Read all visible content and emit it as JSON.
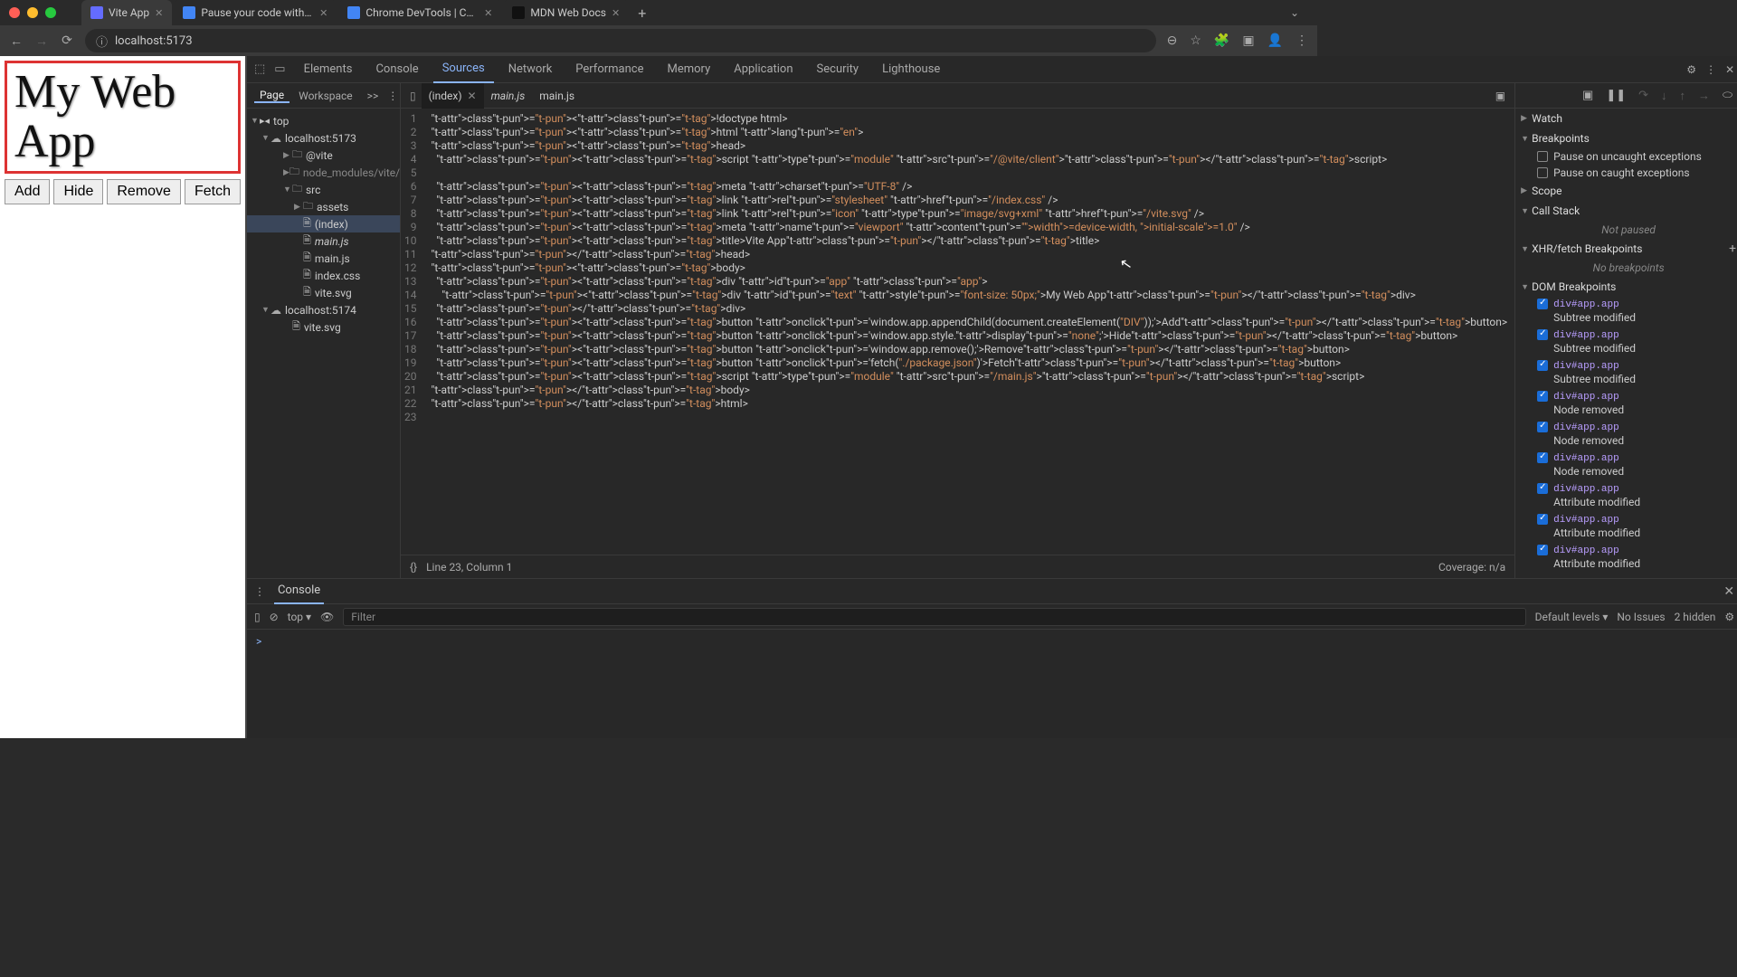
{
  "browser": {
    "tabs": [
      {
        "title": "Vite App",
        "active": true
      },
      {
        "title": "Pause your code with breakp",
        "active": false
      },
      {
        "title": "Chrome DevTools | Chrome",
        "active": false
      },
      {
        "title": "MDN Web Docs",
        "active": false
      }
    ],
    "url": "localhost:5173"
  },
  "page": {
    "heading": "My Web App",
    "buttons": [
      "Add",
      "Hide",
      "Remove",
      "Fetch"
    ]
  },
  "devtools": {
    "tabs": [
      "Elements",
      "Console",
      "Sources",
      "Network",
      "Performance",
      "Memory",
      "Application",
      "Security",
      "Lighthouse"
    ],
    "activeTab": "Sources",
    "leftTabs": {
      "items": [
        "Page",
        "Workspace"
      ],
      "overflow": ">>"
    },
    "filetree": {
      "root": "top",
      "hosts": [
        {
          "name": "localhost:5173",
          "children": [
            {
              "name": "@vite",
              "type": "folder",
              "open": false,
              "depth": 3
            },
            {
              "name": "node_modules/vite/dis",
              "type": "folder",
              "open": false,
              "color": "#888",
              "depth": 3
            },
            {
              "name": "src",
              "type": "folder",
              "open": true,
              "depth": 3
            },
            {
              "name": "assets",
              "type": "folder",
              "open": false,
              "depth": 4
            },
            {
              "name": "(index)",
              "type": "file",
              "selected": true,
              "depth": 4
            },
            {
              "name": "main.js",
              "type": "file",
              "italic": true,
              "depth": 4
            },
            {
              "name": "main.js",
              "type": "file",
              "depth": 4
            },
            {
              "name": "index.css",
              "type": "file",
              "depth": 4
            },
            {
              "name": "vite.svg",
              "type": "file",
              "depth": 4
            }
          ]
        },
        {
          "name": "localhost:5174",
          "children": [
            {
              "name": "vite.svg",
              "type": "file",
              "depth": 3
            }
          ]
        }
      ]
    },
    "editorTabs": [
      {
        "name": "(index)",
        "active": true
      },
      {
        "name": "main.js",
        "italic": true
      },
      {
        "name": "main.js"
      }
    ],
    "code": [
      "<!doctype html>",
      "<html lang=\"en\">",
      "<head>",
      "  <script type=\"module\" src=\"/@vite/client\"></script>",
      "",
      "  <meta charset=\"UTF-8\" />",
      "  <link rel=\"stylesheet\" href=\"/index.css\" />",
      "  <link rel=\"icon\" type=\"image/svg+xml\" href=\"/vite.svg\" />",
      "  <meta name=\"viewport\" content=\"width=device-width, initial-scale=1.0\" />",
      "  <title>Vite App</title>",
      "</head>",
      "<body>",
      "  <div id=\"app\" class=\"app\">",
      "    <div id=\"text\" style=\"font-size: 50px;\">My Web App</div>",
      "  </div>",
      "  <button onclick='window.app.appendChild(document.createElement(\"DIV\"));'>Add</button>",
      "  <button onclick='window.app.style.display=\"none\";'>Hide</button>",
      "  <button onclick='window.app.remove();'>Remove</button>",
      "  <button onclick='fetch(\"./package.json\")'>Fetch</button>",
      "  <script type=\"module\" src=\"/main.js\"></script>",
      "</body>",
      "</html>",
      ""
    ],
    "status": {
      "pos": "Line 23, Column 1",
      "coverage": "Coverage: n/a"
    },
    "debugger": {
      "panes": {
        "watch": "Watch",
        "breakpoints": "Breakpoints",
        "pauseUncaught": "Pause on uncaught exceptions",
        "pauseCaught": "Pause on caught exceptions",
        "scope": "Scope",
        "callStack": "Call Stack",
        "callStackState": "Not paused",
        "xhr": "XHR/fetch Breakpoints",
        "xhrState": "No breakpoints",
        "dom": "DOM Breakpoints"
      },
      "domBreakpoints": [
        {
          "sel": "div#app.app",
          "kind": "Subtree modified"
        },
        {
          "sel": "div#app.app",
          "kind": "Subtree modified"
        },
        {
          "sel": "div#app.app",
          "kind": "Subtree modified"
        },
        {
          "sel": "div#app.app",
          "kind": "Node removed"
        },
        {
          "sel": "div#app.app",
          "kind": "Node removed"
        },
        {
          "sel": "div#app.app",
          "kind": "Node removed"
        },
        {
          "sel": "div#app.app",
          "kind": "Attribute modified"
        },
        {
          "sel": "div#app.app",
          "kind": "Attribute modified"
        },
        {
          "sel": "div#app.app",
          "kind": "Attribute modified"
        }
      ]
    },
    "console": {
      "label": "Console",
      "context": "top",
      "filterPlaceholder": "Filter",
      "levels": "Default levels",
      "issues": "No Issues",
      "hidden": "2 hidden",
      "prompt": ">"
    }
  }
}
